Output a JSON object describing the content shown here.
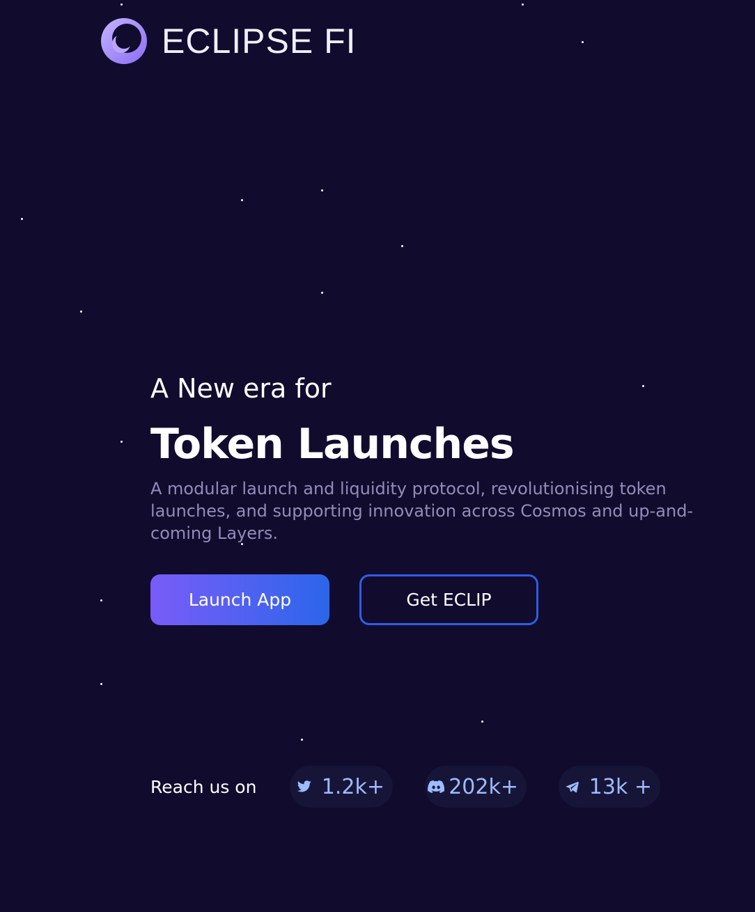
{
  "brand": {
    "name": "ECLIPSE FI",
    "logo_icon": "eclipse-moon-icon",
    "accent_color": "#a78bfa"
  },
  "hero": {
    "eyebrow": "A New era for",
    "title": "Token Launches",
    "description": "A modular launch and liquidity protocol, revolutionising token launches, and supporting innovation across Cosmos and up-and-coming Layers."
  },
  "actions": {
    "primary_label": "Launch App",
    "secondary_label": "Get ECLIP"
  },
  "socials": {
    "label": "Reach us on",
    "items": [
      {
        "platform": "twitter",
        "icon": "twitter-icon",
        "count": "1.2k+"
      },
      {
        "platform": "discord",
        "icon": "discord-icon",
        "count": "202k+"
      },
      {
        "platform": "telegram",
        "icon": "telegram-icon",
        "count": "13k +"
      }
    ]
  },
  "colors": {
    "background": "#110b2e",
    "button_gradient_start": "#7a5cf8",
    "button_gradient_end": "#2b66ea",
    "secondary_border": "#2f5ee6",
    "muted_text": "#948cb8",
    "social_count": "#9cbcff"
  }
}
